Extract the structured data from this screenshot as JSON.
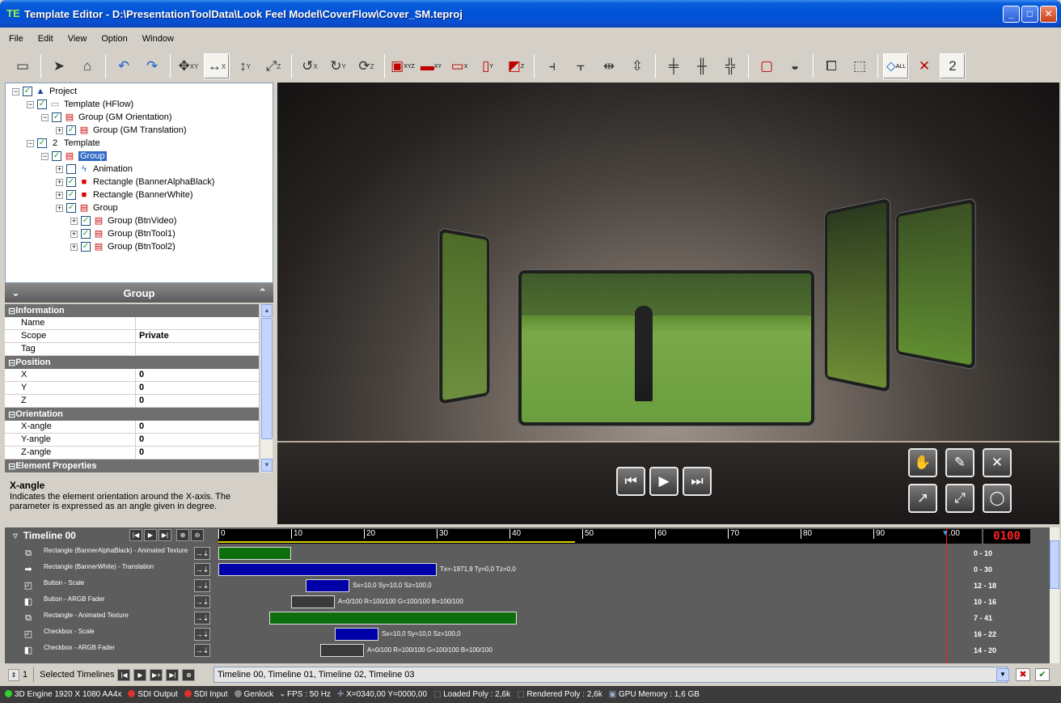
{
  "window": {
    "title": "Template Editor - D:\\PresentationToolData\\Look Feel Model\\CoverFlow\\Cover_SM.teproj",
    "minimize": "_",
    "maximize": "□",
    "close": "✕"
  },
  "menu": [
    "File",
    "Edit",
    "View",
    "Option",
    "Window"
  ],
  "toolbar": {
    "axis_labels": [
      "XY",
      "X",
      "Y",
      "Z",
      "X",
      "Y",
      "Z",
      "XYZ",
      "XY",
      "X",
      "Y",
      "Z",
      "ALL",
      "2"
    ]
  },
  "tree": [
    {
      "depth": 0,
      "label": "Project",
      "icon": "triangle-icon"
    },
    {
      "depth": 1,
      "label": "Template (HFlow)",
      "icon": "page-icon"
    },
    {
      "depth": 2,
      "label": "Group (GM Orientation)",
      "icon": "group-icon"
    },
    {
      "depth": 3,
      "label": "Group (GM Translation)",
      "icon": "group-icon"
    },
    {
      "depth": 1,
      "label": "Template",
      "icon": "template-2-icon"
    },
    {
      "depth": 2,
      "label": "Group",
      "icon": "group-icon",
      "selected": true
    },
    {
      "depth": 3,
      "label": "Animation",
      "icon": "lightning-icon",
      "unchecked": true
    },
    {
      "depth": 3,
      "label": "Rectangle (BannerAlphaBlack)",
      "icon": "rectangle-icon"
    },
    {
      "depth": 3,
      "label": "Rectangle (BannerWhite)",
      "icon": "rectangle-icon"
    },
    {
      "depth": 3,
      "label": "Group",
      "icon": "group-icon"
    },
    {
      "depth": 4,
      "label": "Group (BtnVideo)",
      "icon": "group-icon"
    },
    {
      "depth": 4,
      "label": "Group (BtnTool1)",
      "icon": "group-icon"
    },
    {
      "depth": 4,
      "label": "Group (BtnTool2)",
      "icon": "group-icon"
    }
  ],
  "properties": {
    "title": "Group",
    "rows": [
      {
        "type": "cat",
        "label": "Information"
      },
      {
        "type": "row",
        "key": "Name",
        "value": ""
      },
      {
        "type": "row",
        "key": "Scope",
        "value": "Private"
      },
      {
        "type": "row",
        "key": "Tag",
        "value": ""
      },
      {
        "type": "cat",
        "label": "Position"
      },
      {
        "type": "row",
        "key": "X",
        "value": "0"
      },
      {
        "type": "row",
        "key": "Y",
        "value": "0"
      },
      {
        "type": "row",
        "key": "Z",
        "value": "0"
      },
      {
        "type": "cat",
        "label": "Orientation"
      },
      {
        "type": "row",
        "key": "X-angle",
        "value": "0"
      },
      {
        "type": "row",
        "key": "Y-angle",
        "value": "0"
      },
      {
        "type": "row",
        "key": "Z-angle",
        "value": "0"
      },
      {
        "type": "cat",
        "label": "Element Properties"
      }
    ],
    "help_title": "X-angle",
    "help_text": "Indicates the element orientation around the X-axis. The parameter is expressed as an angle given in degree."
  },
  "viewport": {
    "transport": [
      "⏮",
      "▶",
      "⏭"
    ],
    "tools": [
      "✋",
      "✎",
      "✕",
      "↗",
      "⤢",
      "◯"
    ]
  },
  "timeline": {
    "name": "Timeline 00",
    "frame": "0100",
    "ruler": [
      "0",
      "10",
      "20",
      "30",
      "40",
      "50",
      "60",
      "70",
      "80",
      "90",
      ".00"
    ],
    "cursor_frame": 100,
    "tracks": [
      {
        "icon": "animated-texture-icon",
        "label": "Rectangle (BannerAlphaBlack) - Animated Texture",
        "color": "g",
        "start": 0,
        "end": 10,
        "info": "",
        "range": "0 - 10"
      },
      {
        "icon": "translation-arrow-icon",
        "label": "Rectangle (BannerWhite) - Translation",
        "color": "b",
        "start": 0,
        "end": 30,
        "info": "Tx=-1971,9 Ty=0,0 Tz=0,0",
        "range": "0 - 30"
      },
      {
        "icon": "scale-icon",
        "label": "Button - Scale",
        "color": "b",
        "start": 12,
        "end": 18,
        "info": "Sx=10,0 Sy=10,0 Sz=100,0",
        "range": "12 - 18"
      },
      {
        "icon": "argb-fader-icon",
        "label": "Button - ARGB Fader",
        "color": "d",
        "start": 10,
        "end": 16,
        "info": "A=0/100 R=100/100 G=100/100 B=100/100",
        "range": "10 - 16"
      },
      {
        "icon": "animated-texture-icon",
        "label": "Rectangle - Animated Texture",
        "color": "g",
        "start": 7,
        "end": 41,
        "info": "",
        "range": "7 - 41"
      },
      {
        "icon": "scale-icon",
        "label": "Checkbox - Scale",
        "color": "b",
        "start": 16,
        "end": 22,
        "info": "Sx=10,0 Sy=10,0 Sz=100,0",
        "range": "16 - 22"
      },
      {
        "icon": "argb-fader-icon",
        "label": "Checkbox - ARGB Fader",
        "color": "d",
        "start": 14,
        "end": 20,
        "info": "A=0/100 R=100/100 G=100/100 B=100/100",
        "range": "14 - 20"
      }
    ]
  },
  "selected_timelines": {
    "spinner": "1",
    "label": "Selected Timelines",
    "value": "Timeline 00, Timeline 01, Timeline 02, Timeline 03"
  },
  "status": [
    {
      "icon": "green-dot-icon",
      "text": "3D Engine 1920 X 1080  AA4x"
    },
    {
      "icon": "red-dot-icon",
      "text": "SDI Output"
    },
    {
      "icon": "red-dot-icon",
      "text": "SDI Input"
    },
    {
      "icon": "gray-dot-icon",
      "text": "Genlock"
    },
    {
      "icon": "speedometer-icon",
      "text": "FPS : 50 Hz"
    },
    {
      "icon": "crosshair-icon",
      "text": "X=0340,00 Y=0000,00"
    },
    {
      "icon": "poly-icon",
      "text": "Loaded Poly : 2,6k"
    },
    {
      "icon": "poly-icon",
      "text": "Rendered Poly : 2,6k"
    },
    {
      "icon": "memory-icon",
      "text": "GPU Memory : 1,6 GB"
    }
  ]
}
